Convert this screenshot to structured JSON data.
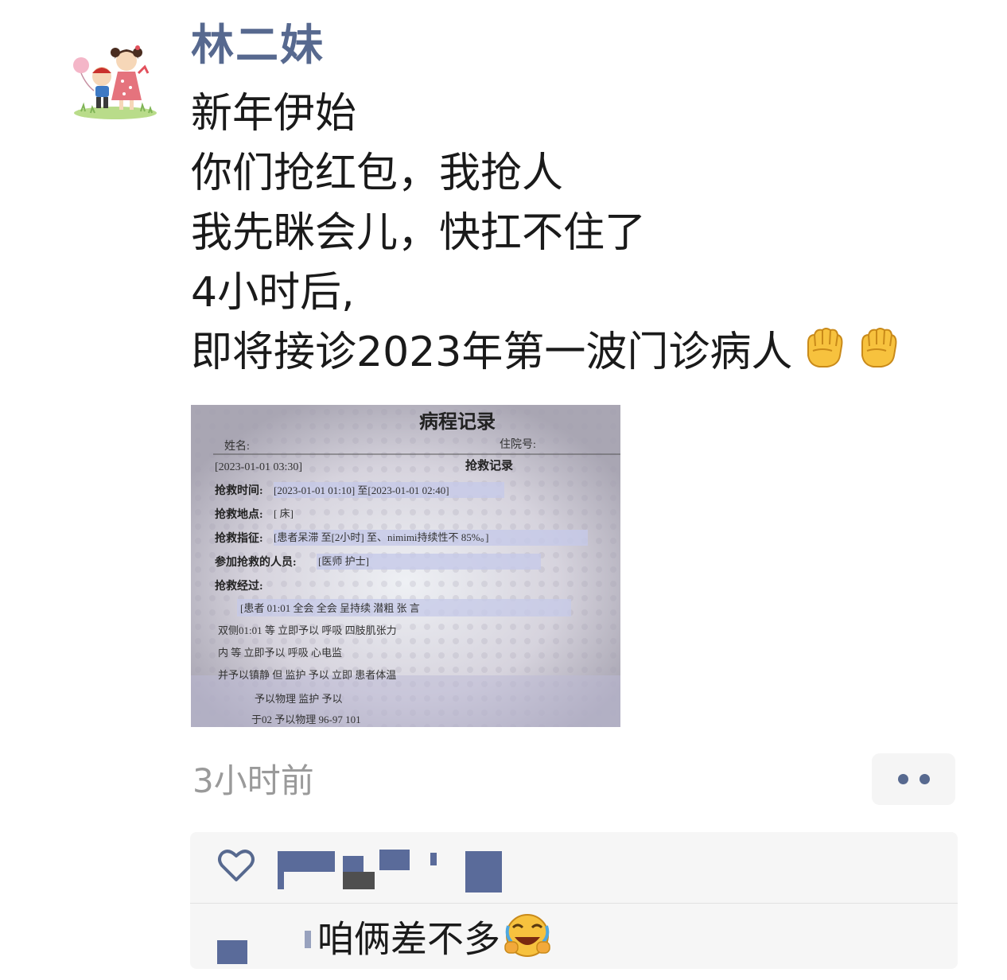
{
  "post": {
    "author": "林二妹",
    "lines": [
      "新年伊始",
      "你们抢红包，我抢人",
      "我先眯会儿，快扛不住了",
      "4小时后,",
      "即将接诊2023年第一波门诊病人"
    ],
    "line_end_emoji": [
      "raised-fist-emoji",
      "raised-fist-emoji"
    ],
    "timestamp": "3小时前"
  },
  "photo": {
    "title": "病程记录",
    "name_label": "姓名:",
    "admission_label": "住院号:",
    "record_time": "[2023-01-01 03:30]",
    "record_type": "抢救记录",
    "rescue_time_label": "抢救时间:",
    "rescue_time_value": "[2023-01-01 01:10] 至[2023-01-01 02:40]",
    "rescue_location_label": "抢救地点:",
    "rescue_location_value": "[  床]",
    "rescue_indication_label": "抢救指征:",
    "rescue_indication_value": "[患者呆滞 至[2小时] 至、nimimi持续性不 85%。]",
    "participants_label": "参加抢救的人员:",
    "participants_value": "[医师 护士]",
    "process_label": "抢救经过:",
    "body_lines": [
      "[患者 01:01 全会 全会 呈持续 潜粗 张 言",
      "双侧01:01 等 立即予以 呼吸 四肢肌张力",
      "内 等 立即予以 呼吸 心电监",
      "并予以镇静 但 监护 予以 立即 患者体温",
      "予以物理 监护 予以",
      "于02 予以物理 96-97 101"
    ]
  },
  "interactions": {
    "comment_text": "咱俩差不多",
    "comment_emoji": "rolling-laughing-emoji"
  },
  "colors": {
    "author_name": "#57698f",
    "timestamp": "#9a9a9a",
    "interaction_bg": "#f6f6f6",
    "more_button_bg": "#f5f5f5",
    "redaction_block": "#5a6b9a"
  }
}
